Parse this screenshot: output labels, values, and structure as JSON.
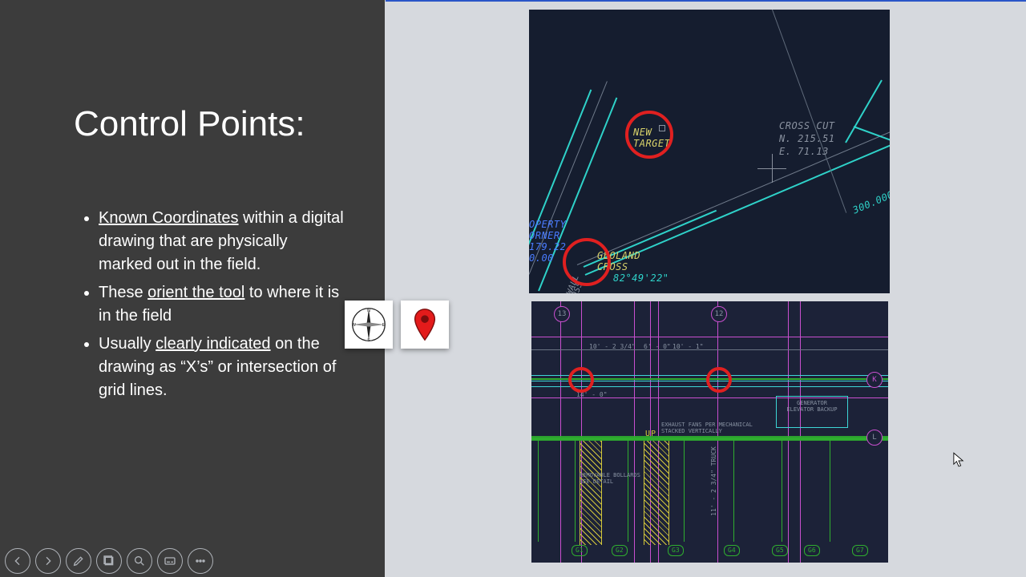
{
  "title": "Control Points:",
  "bullets": {
    "b1": {
      "u": "Known Coordinates",
      "rest": " within a digital drawing that are physically marked out in the field."
    },
    "b2": {
      "pre": "These ",
      "u": "orient the tool",
      "rest": " to where it is in the field"
    },
    "b3": {
      "pre": "Usually ",
      "u": "clearly indicated",
      "rest": " on the drawing as “X’s” or intersection of grid lines."
    }
  },
  "cad1": {
    "new_target": "NEW\nTARGET",
    "cross_cut_label": "CROSS CUT",
    "cross_cut_n": "N. 215.51",
    "cross_cut_e": "E. 71.13",
    "prop_corner_1": "OPERTY",
    "prop_corner_2": "ORNER",
    "prop_corner_3": "179.22",
    "prop_corner_4": "0.00",
    "geoland_1": "GEOLAND",
    "geoland_2": "CROSS",
    "bearing": "82°49'22\"",
    "dist": "300.000'",
    "wall": "WALL",
    "cross": "CROSS"
  },
  "cad2": {
    "note1": "EXHAUST FANS PER MECHANICAL\nSTACKED VERTICALLY",
    "note2": "REMOVABLE BOLLARDS\nSEE DETAIL",
    "gen1": "GENERATOR",
    "gen2": "ELEVATOR BACKUP",
    "dim1": "10' - 2 3/4\"",
    "dim2": "6' - 0\"",
    "dim3": "10' - 1\"",
    "dim4": "11' - 2 3/4\" TRUCK",
    "dim5": "14' - 0\"",
    "up": "UP",
    "g_labels": [
      "G1",
      "G2",
      "G3",
      "G4",
      "G5",
      "G6",
      "G7"
    ]
  },
  "icons": {
    "compass": "compass-icon",
    "pin": "map-pin-icon"
  },
  "toolbar": [
    "previous",
    "next",
    "pen",
    "sections",
    "magnify",
    "subtitles",
    "more"
  ]
}
